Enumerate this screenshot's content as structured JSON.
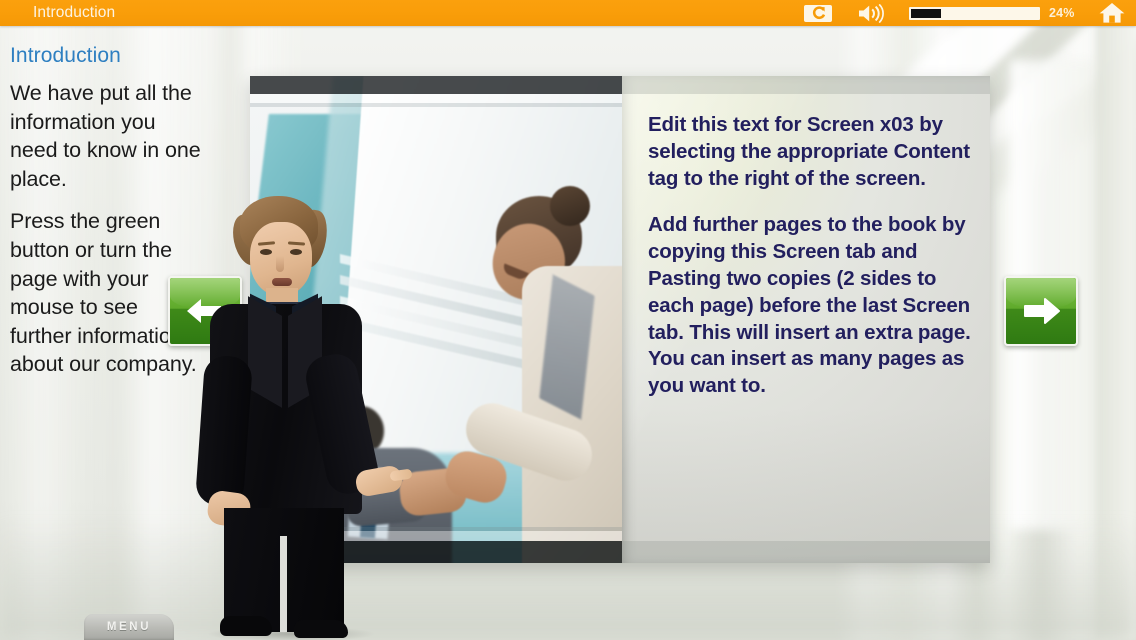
{
  "topbar": {
    "title": "Introduction",
    "replay_icon": "replay-icon",
    "volume_icon": "speaker-icon",
    "home_icon": "home-icon",
    "progress_percent": 24,
    "progress_label": "24%",
    "accent_color": "#f99d09",
    "progress_fill_color": "#111111",
    "progress_track_color": "#fdf7e9"
  },
  "left_column": {
    "heading": "Introduction",
    "heading_color": "#2e7fc1",
    "paragraphs": [
      "We have put all the information you need to know in one place.",
      "Press the green button or turn the page with your mouse to see further information about our company."
    ]
  },
  "spread": {
    "left_page": {
      "type": "photo",
      "alt": "Business handshake between a woman in a beige blazer and a seated man"
    },
    "right_page": {
      "text_color": "#221f5e",
      "paragraphs": [
        "Edit this text for Screen x03 by selecting the appropriate Content tag to the right of the screen.",
        "Add further pages to the book by copying this Screen tab and Pasting two copies (2 sides to each page) before the last Screen tab.  This will insert an extra page. You can insert as many pages as you want to."
      ]
    }
  },
  "presenter": {
    "alt": "Presenter in a dark suit gesturing toward the page"
  },
  "nav": {
    "prev_icon": "arrow-left-icon",
    "next_icon": "arrow-right-icon",
    "button_color": "#5faa2c"
  },
  "menu": {
    "label": "MENU"
  }
}
